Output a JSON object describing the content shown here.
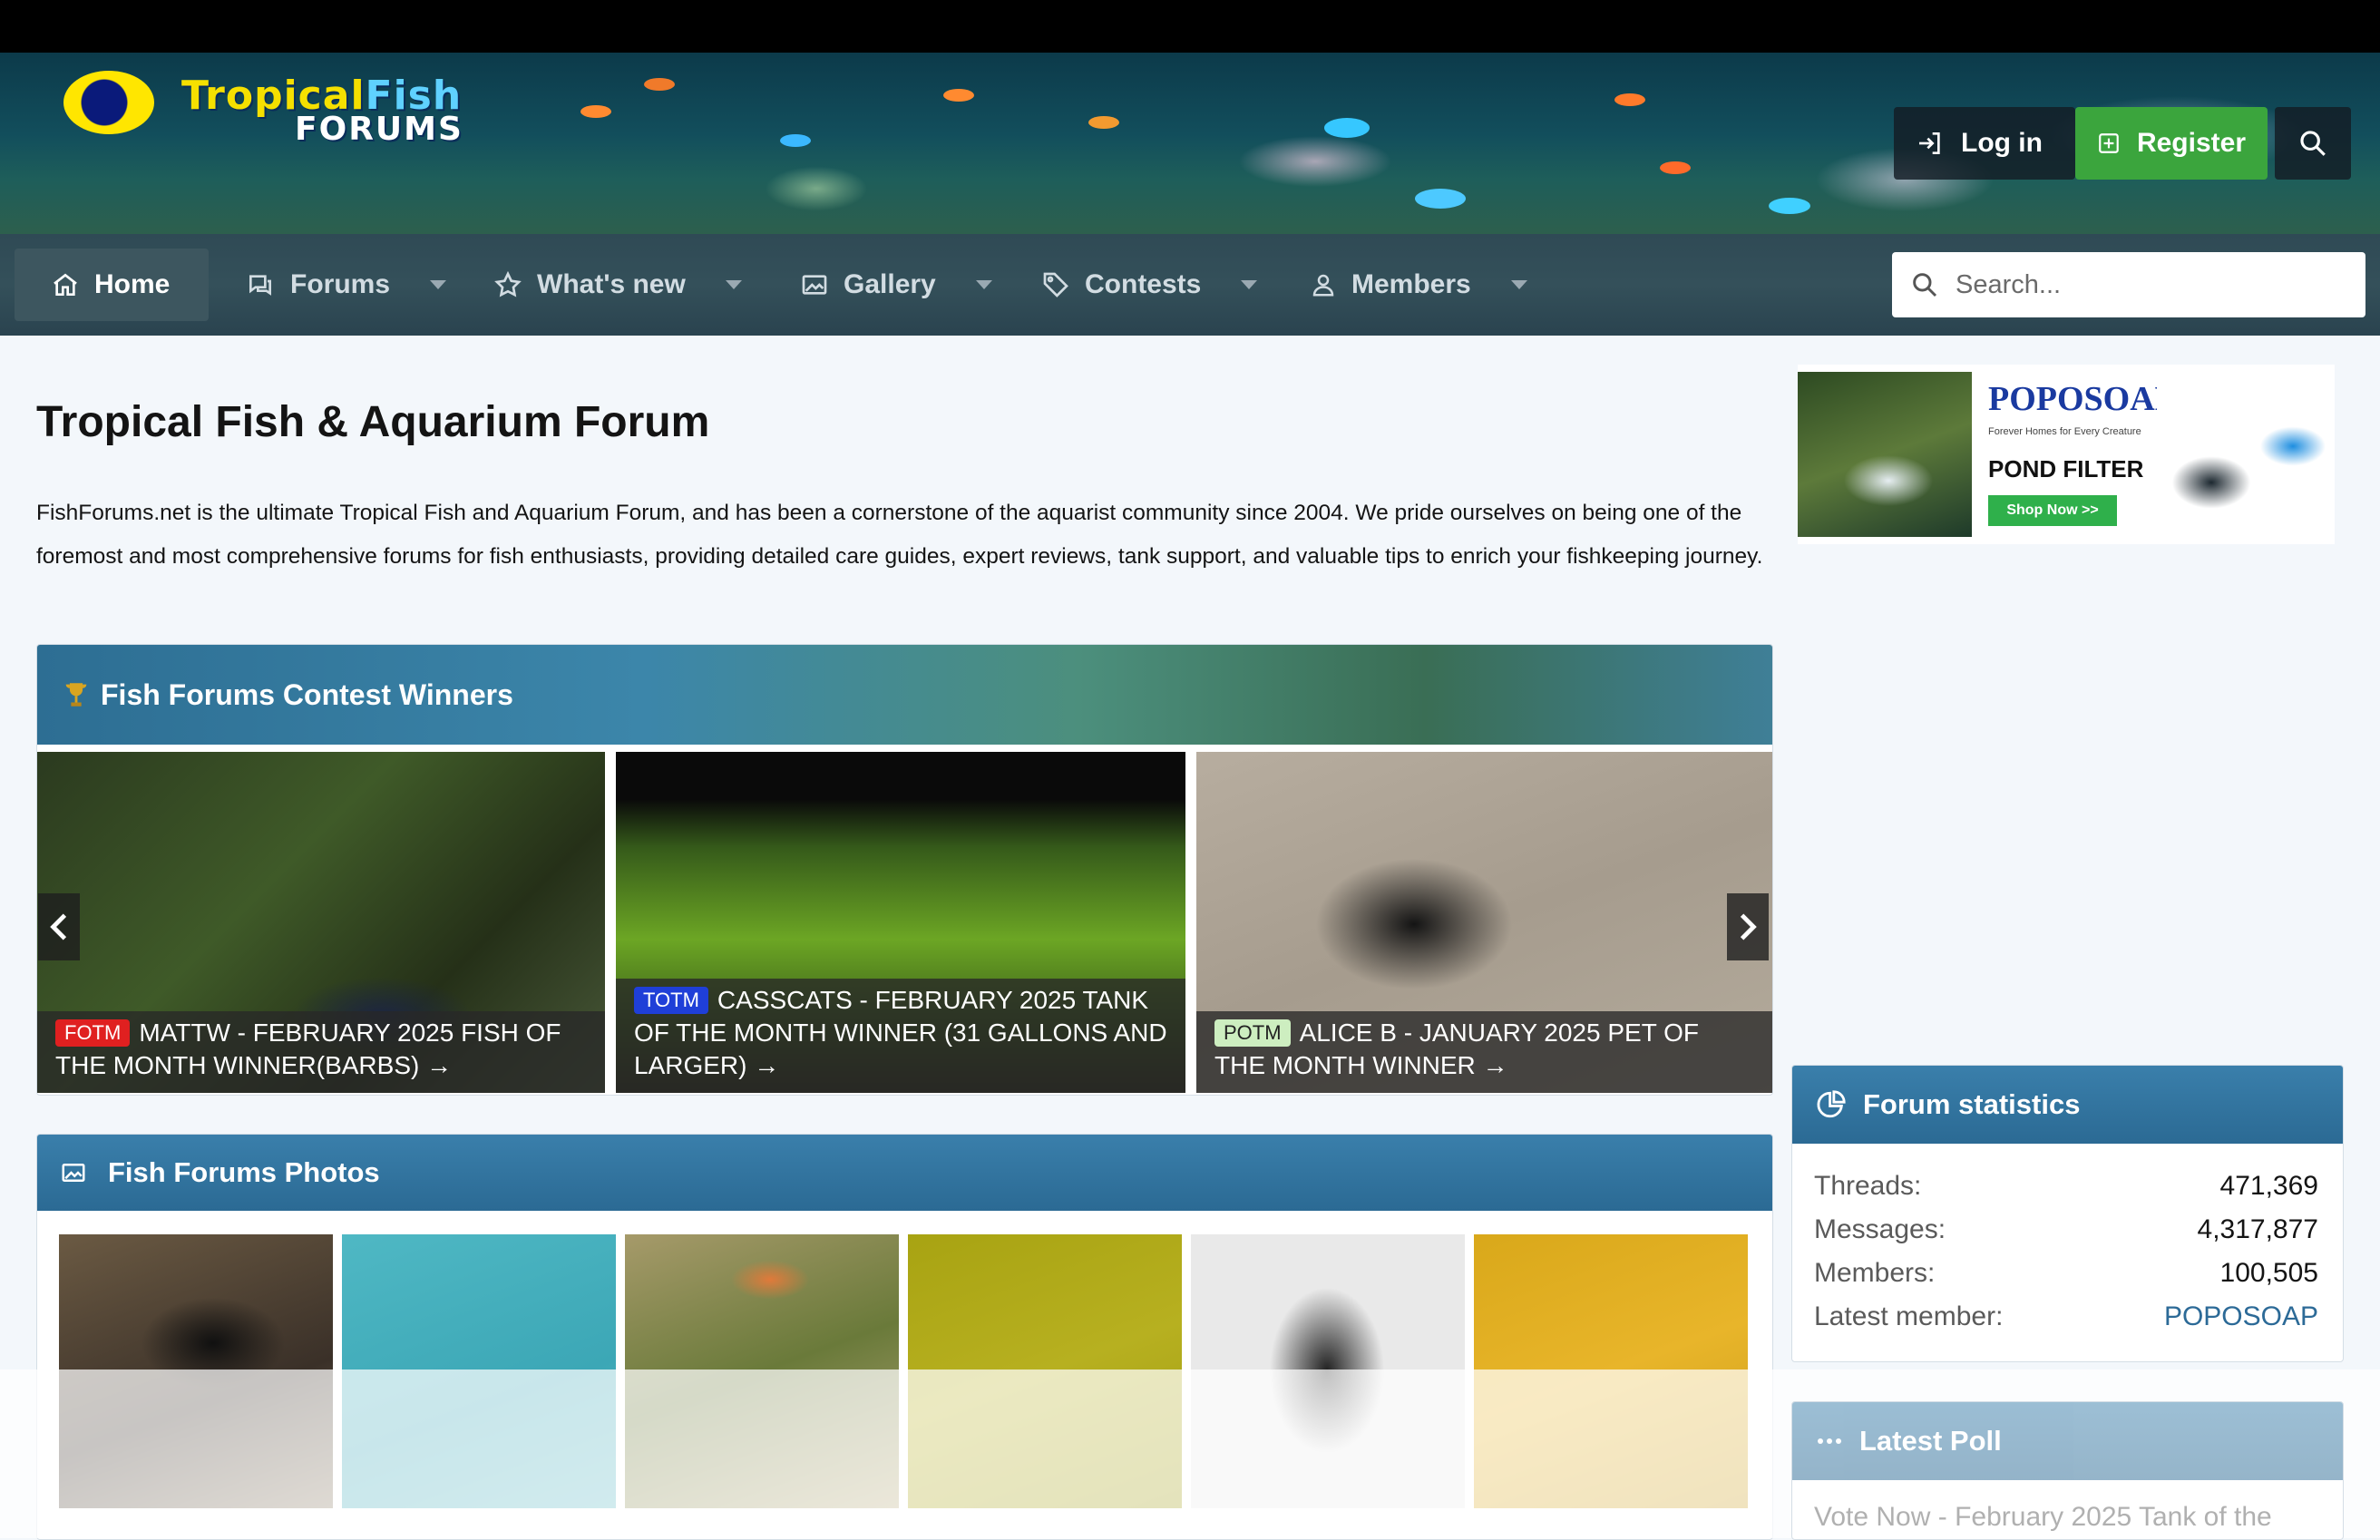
{
  "header": {
    "logo": {
      "word1": "Tropical",
      "word2": "Fish",
      "word3": "FORUMS"
    },
    "login_label": "Log in",
    "register_label": "Register",
    "icons": {
      "login": "login-icon",
      "register": "plus-square-icon",
      "search": "search-icon"
    }
  },
  "nav": {
    "items": [
      {
        "label": "Home",
        "icon": "home-icon"
      },
      {
        "label": "Forums",
        "icon": "chat-icon"
      },
      {
        "label": "What's new",
        "icon": "star-icon"
      },
      {
        "label": "Gallery",
        "icon": "image-icon"
      },
      {
        "label": "Contests",
        "icon": "tag-icon"
      },
      {
        "label": "Members",
        "icon": "user-icon"
      }
    ],
    "search_placeholder": "Search..."
  },
  "main": {
    "title": "Tropical Fish & Aquarium Forum",
    "description": "FishForums.net is the ultimate Tropical Fish and Aquarium Forum, and has been a cornerstone of the aquarist community since 2004. We pride ourselves on being one of the foremost and most comprehensive forums for fish enthusiasts, providing detailed care guides, expert reviews, tank support, and valuable tips to enrich your fishkeeping journey."
  },
  "contest": {
    "title": "Fish Forums Contest Winners",
    "icon": "trophy-icon",
    "slides": [
      {
        "badge": "FOTM",
        "badge_color": "#e02020",
        "text": "MATTW - FEBRUARY 2025 FISH OF THE MONTH WINNER(BARBS)",
        "arrow": "→"
      },
      {
        "badge": "TOTM",
        "badge_color": "#1f3fd8",
        "text": "CASSCATS - FEBRUARY 2025 TANK OF THE MONTH WINNER (31 GALLONS AND LARGER)",
        "arrow": "→"
      },
      {
        "badge": "POTM",
        "badge_color": "#cdeec0",
        "text": "ALICE B - JANUARY 2025 PET OF THE MONTH WINNER",
        "arrow": "→"
      }
    ]
  },
  "photos": {
    "title": "Fish Forums Photos",
    "icon": "image-icon"
  },
  "ad": {
    "brand": "POPOSOAP",
    "tagline": "Forever Homes for Every Creature",
    "product": "POND FILTER",
    "cta": "Shop Now >>"
  },
  "stats": {
    "title": "Forum statistics",
    "icon": "pie-chart-icon",
    "rows": [
      {
        "label": "Threads:",
        "value": "471,369"
      },
      {
        "label": "Messages:",
        "value": "4,317,877"
      },
      {
        "label": "Members:",
        "value": "100,505"
      },
      {
        "label": "Latest member:",
        "value": "POPOSOAP"
      }
    ]
  },
  "poll": {
    "title": "Latest Poll",
    "icon": "dots-icon",
    "text": "Vote Now - February 2025 Tank of the"
  },
  "colors": {
    "accent": "#2c6a97",
    "register": "#3ba53d",
    "nav": "#34505a"
  }
}
